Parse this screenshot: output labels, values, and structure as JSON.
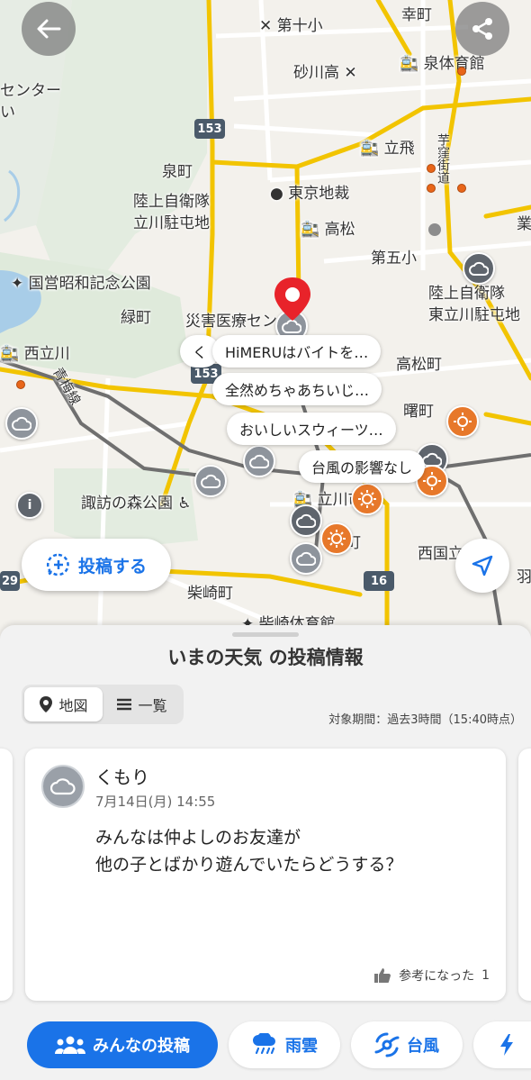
{
  "map": {
    "labels": {
      "dai10sho": "第十小",
      "saiwaicho": "幸町",
      "izumi_taiikukan": "泉体育館",
      "sunagawa_ko": "砂川高",
      "center": "センター",
      "i": "い",
      "tachihi": "立飛",
      "hanekubo": "芋窪街道",
      "izumicho": "泉町",
      "tokyo_chisai": "東京地裁",
      "jieitai_tachikawa": "陸上自衛隊\n立川駐屯地",
      "takamatsu": "高松",
      "dai5sho": "第五小",
      "showa_kinen": "国営昭和記念公園",
      "midoricho": "緑町",
      "saigai_center": "災害医療セン",
      "jieitai_higashi": "陸上自衛隊\n東立川駐屯地",
      "nishi_tachikawa": "西立川",
      "takamatsucho": "高松町",
      "ome_line": "青梅線",
      "akebonocho": "曙町",
      "suwa_no_mori": "諏訪の森公園",
      "tachikawa_eki": "立川市",
      "nishikunitachi": "西国立",
      "shibasakicho": "柴崎町",
      "shibasaki_taiikukan": "柴崎体育館",
      "cho": "町",
      "ha": "羽",
      "gyo": "業"
    },
    "route_shields": [
      "153",
      "153",
      "16",
      "29"
    ],
    "bubbles": [
      "く",
      "HiMERUはバイトを…",
      "全然めちゃあちいじ…",
      "おいしいスウィーツ…",
      "台風の影響なし"
    ],
    "post_button_label": "投稿する"
  },
  "sheet": {
    "title": "いまの天気 の投稿情報",
    "segments": [
      {
        "label": "地図",
        "icon": "map-pin-icon",
        "active": true
      },
      {
        "label": "一覧",
        "icon": "list-icon",
        "active": false
      }
    ],
    "period": "対象期間：過去3時間（15:40時点）",
    "card": {
      "weather": "くもり",
      "date": "7月14日(月) 14:55",
      "body_line1": "みんなは仲よしのお友達が",
      "body_line2": "他の子とばかり遊んでいたらどうする？",
      "helpful_label": "参考になった",
      "helpful_count": "1"
    },
    "tabs": [
      {
        "label": "みんなの投稿",
        "icon": "people-icon",
        "active": true
      },
      {
        "label": "雨雲",
        "icon": "rain-cloud-icon",
        "active": false
      },
      {
        "label": "台風",
        "icon": "typhoon-icon",
        "active": false
      },
      {
        "label": "",
        "icon": "lightning-icon",
        "active": false
      }
    ]
  },
  "colors": {
    "accent": "#1a73e8",
    "road_major": "#f2c400",
    "pin_red": "#e8232a",
    "sun_orange": "#e7782a"
  }
}
